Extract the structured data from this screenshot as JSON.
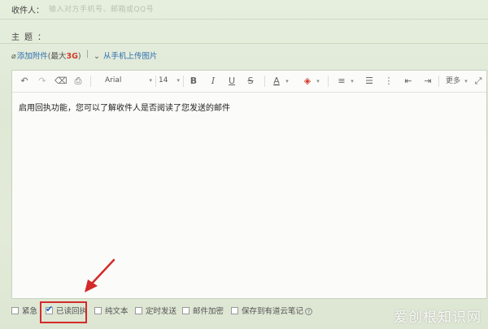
{
  "recipient": {
    "label": "收件人：",
    "placeholder": "输入对方手机号、邮箱或QQ号"
  },
  "subject": {
    "label": "主题："
  },
  "attachment": {
    "add_label": "添加附件",
    "max_prefix": "(最大",
    "max_value": "3G",
    "max_suffix": ")",
    "separator": "|",
    "upload_label": "从手机上传图片"
  },
  "toolbar": {
    "font_family": "Arial",
    "font_size": "14",
    "bold": "B",
    "italic": "I",
    "underline": "U",
    "strike": "S",
    "font_color": "A",
    "more_label": "更多"
  },
  "editor": {
    "body_text": "启用回执功能，您可以了解收件人是否阅读了您发送的邮件"
  },
  "options": [
    {
      "label": "紧急",
      "checked": false
    },
    {
      "label": "已读回执",
      "checked": true
    },
    {
      "label": "纯文本",
      "checked": false
    },
    {
      "label": "定时发送",
      "checked": false
    },
    {
      "label": "邮件加密",
      "checked": false
    },
    {
      "label": "保存到有道云笔记",
      "checked": false
    }
  ],
  "watermark": "爱创根知识网",
  "colors": {
    "highlight": "#d42a2a",
    "link": "#2f6fb0",
    "size_emphasis": "#d23a2a"
  }
}
